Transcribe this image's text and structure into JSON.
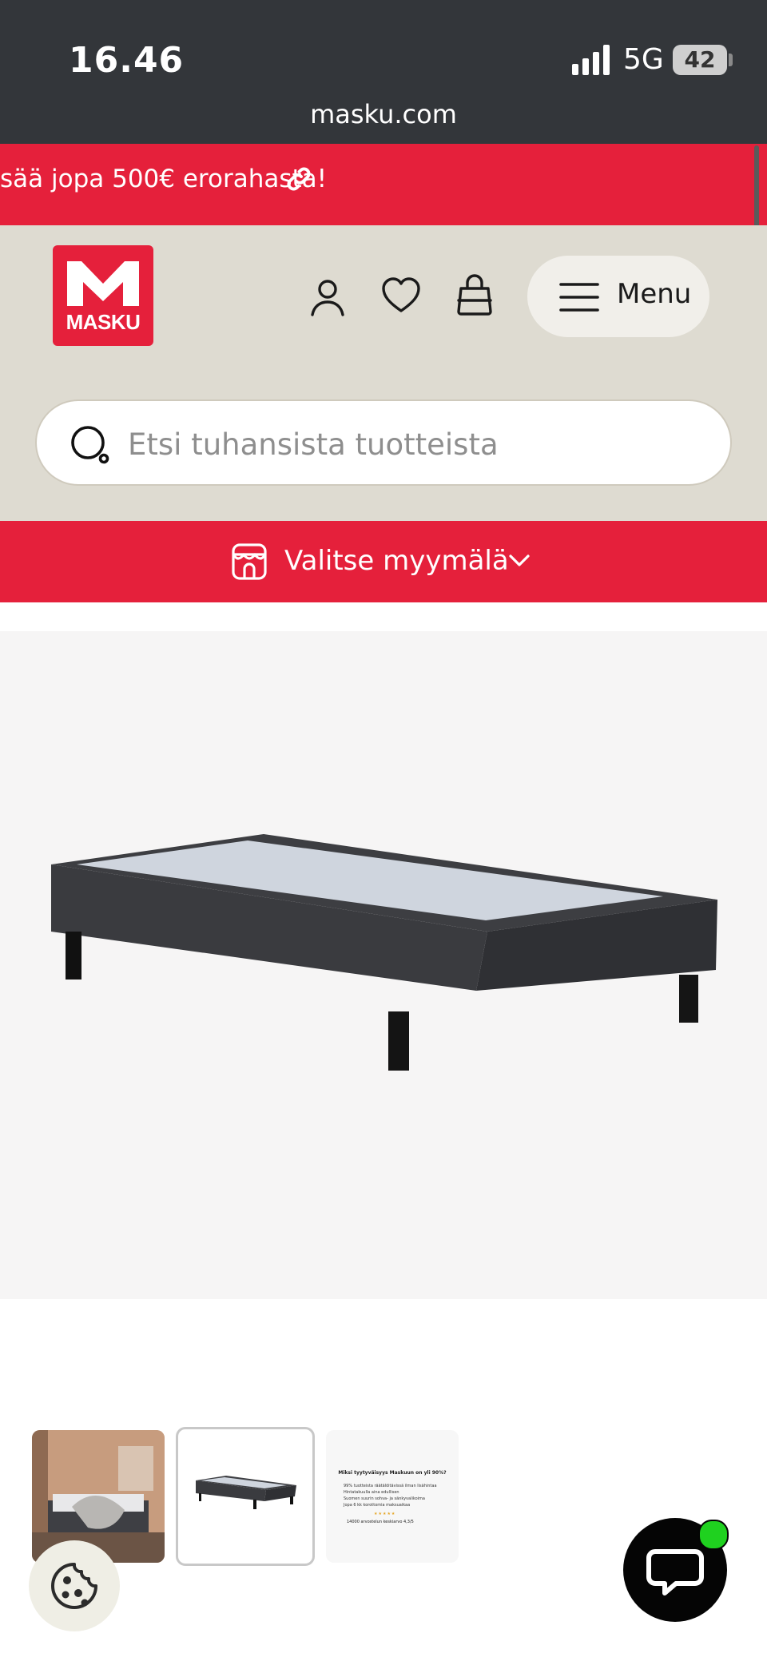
{
  "status_bar": {
    "time": "16.46",
    "network": "5G",
    "battery": "42"
  },
  "browser": {
    "url": "masku.com"
  },
  "promo_banner": {
    "text": "sää jopa 500€ erorahasta!",
    "background": "#e5203b",
    "link_icon": "link-icon"
  },
  "header": {
    "logo_text": "MASKU",
    "brand_color": "#e5203b",
    "background": "#dedbd1",
    "icons": [
      "user-icon",
      "heart-icon",
      "shopping-bag-icon"
    ],
    "menu_label": "Menu"
  },
  "search": {
    "placeholder": "Etsi tuhansista tuotteista",
    "value": ""
  },
  "store_selector": {
    "label": "Valitse myymälä",
    "icon": "store-icon"
  },
  "gallery": {
    "main_image": "bed-base-dark-grey",
    "thumbnails": [
      {
        "description": "bed-in-bedroom",
        "selected": false
      },
      {
        "description": "bed-base",
        "selected": true
      },
      {
        "description": "info-card",
        "selected": false
      }
    ],
    "info_card": {
      "title": "Miksi tyytyväisyys Maskuun on yli 90%?",
      "lines": [
        "99% tuotteista räätälöitävissä ilman lisähintaa",
        "Hintatakuulla aina edullisen",
        "Suomen suurin sohva- ja sänkyvalikoima",
        "Jopa 6 kk korottomia maksuaikaa"
      ],
      "rating_line": "14000 arvostelun keskiarvo 4,3/5"
    }
  },
  "floating": {
    "cookie_icon": "cookie-icon",
    "chat_icon": "chat-icon",
    "chat_status_color": "#1fd11f"
  }
}
